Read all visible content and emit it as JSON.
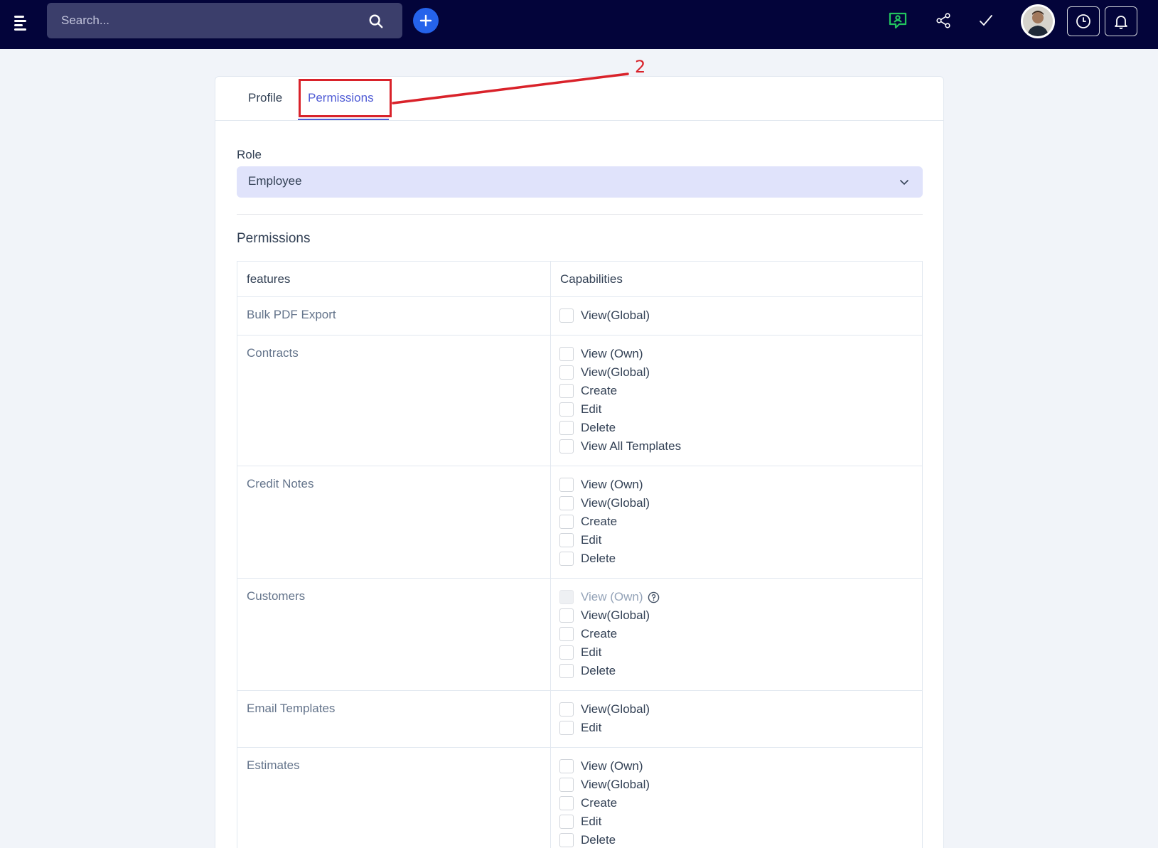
{
  "topbar": {
    "search_placeholder": "Search...",
    "icons": [
      "menu-icon",
      "search-icon",
      "plus-icon",
      "chat-icon",
      "share-icon",
      "check-icon",
      "avatar",
      "clock-icon",
      "bell-icon"
    ],
    "colors": {
      "bar": "#03043a",
      "add": "#2563eb",
      "chat": "#22c55e"
    }
  },
  "tabs": {
    "profile": "Profile",
    "permissions": "Permissions",
    "active": "permissions"
  },
  "role": {
    "label": "Role",
    "value": "Employee"
  },
  "permissions_heading": "Permissions",
  "table": {
    "headers": {
      "features": "features",
      "capabilities": "Capabilities"
    },
    "rows": [
      {
        "feature": "Bulk PDF Export",
        "caps": [
          {
            "label": "View(Global)",
            "checked": false,
            "disabled": false
          }
        ]
      },
      {
        "feature": "Contracts",
        "caps": [
          {
            "label": "View (Own)",
            "checked": false,
            "disabled": false
          },
          {
            "label": "View(Global)",
            "checked": false,
            "disabled": false
          },
          {
            "label": "Create",
            "checked": false,
            "disabled": false
          },
          {
            "label": "Edit",
            "checked": false,
            "disabled": false
          },
          {
            "label": "Delete",
            "checked": false,
            "disabled": false
          },
          {
            "label": "View All Templates",
            "checked": false,
            "disabled": false
          }
        ]
      },
      {
        "feature": "Credit Notes",
        "caps": [
          {
            "label": "View (Own)",
            "checked": false,
            "disabled": false
          },
          {
            "label": "View(Global)",
            "checked": false,
            "disabled": false
          },
          {
            "label": "Create",
            "checked": false,
            "disabled": false
          },
          {
            "label": "Edit",
            "checked": false,
            "disabled": false
          },
          {
            "label": "Delete",
            "checked": false,
            "disabled": false
          }
        ]
      },
      {
        "feature": "Customers",
        "caps": [
          {
            "label": "View (Own)",
            "checked": false,
            "disabled": true,
            "help": true
          },
          {
            "label": "View(Global)",
            "checked": false,
            "disabled": false
          },
          {
            "label": "Create",
            "checked": false,
            "disabled": false
          },
          {
            "label": "Edit",
            "checked": false,
            "disabled": false
          },
          {
            "label": "Delete",
            "checked": false,
            "disabled": false
          }
        ]
      },
      {
        "feature": "Email Templates",
        "caps": [
          {
            "label": "View(Global)",
            "checked": false,
            "disabled": false
          },
          {
            "label": "Edit",
            "checked": false,
            "disabled": false
          }
        ]
      },
      {
        "feature": "Estimates",
        "caps": [
          {
            "label": "View (Own)",
            "checked": false,
            "disabled": false
          },
          {
            "label": "View(Global)",
            "checked": false,
            "disabled": false
          },
          {
            "label": "Create",
            "checked": false,
            "disabled": false
          },
          {
            "label": "Edit",
            "checked": false,
            "disabled": false
          },
          {
            "label": "Delete",
            "checked": false,
            "disabled": false
          }
        ]
      }
    ]
  },
  "annotation": {
    "number": "2",
    "color": "#d9222a"
  }
}
